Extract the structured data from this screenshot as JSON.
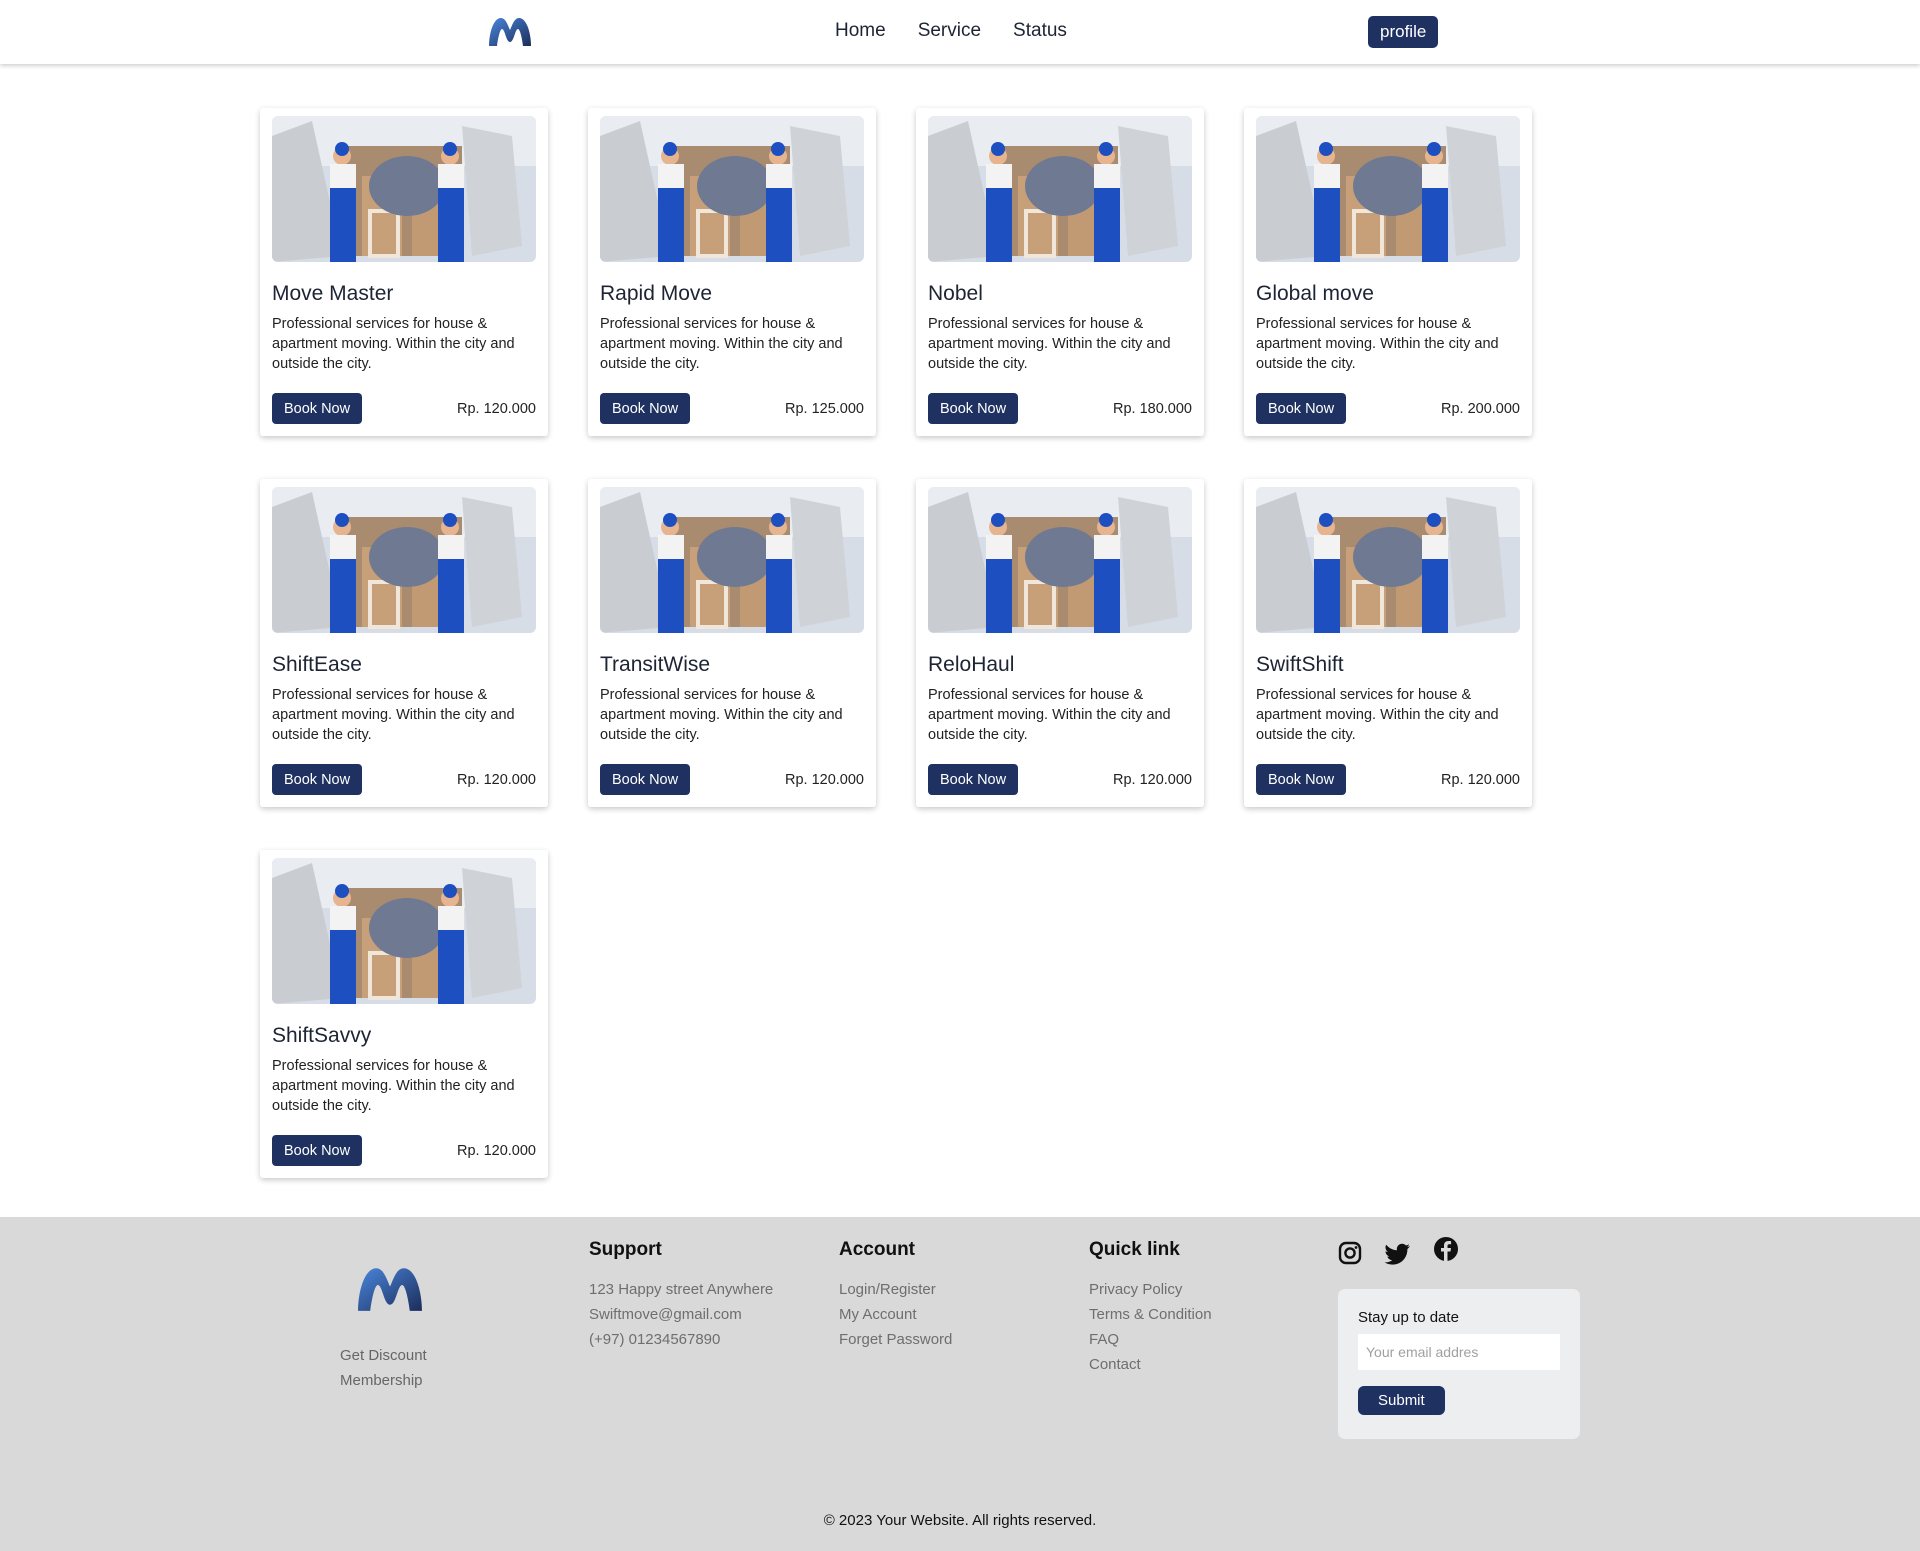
{
  "header": {
    "nav": [
      "Home",
      "Service",
      "Status"
    ],
    "profile_label": "profile"
  },
  "cards": [
    {
      "title": "Move Master",
      "description": "Professional services for house & apartment moving. Within the city and outside the city.",
      "button": "Book Now",
      "price": "Rp. 120.000"
    },
    {
      "title": "Rapid Move",
      "description": "Professional services for house & apartment moving. Within the city and outside the city.",
      "button": "Book Now",
      "price": "Rp. 125.000"
    },
    {
      "title": "Nobel",
      "description": "Professional services for house & apartment moving. Within the city and outside the city.",
      "button": "Book Now",
      "price": "Rp. 180.000"
    },
    {
      "title": "Global move",
      "description": "Professional services for house & apartment moving. Within the city and outside the city.",
      "button": "Book Now",
      "price": "Rp. 200.000"
    },
    {
      "title": "ShiftEase",
      "description": "Professional services for house & apartment moving. Within the city and outside the city.",
      "button": "Book Now",
      "price": "Rp. 120.000"
    },
    {
      "title": "TransitWise",
      "description": "Professional services for house & apartment moving. Within the city and outside the city.",
      "button": "Book Now",
      "price": "Rp. 120.000"
    },
    {
      "title": "ReloHaul",
      "description": "Professional services for house & apartment moving. Within the city and outside the city.",
      "button": "Book Now",
      "price": "Rp. 120.000"
    },
    {
      "title": "SwiftShift",
      "description": "Professional services for house & apartment moving. Within the city and outside the city.",
      "button": "Book Now",
      "price": "Rp. 120.000"
    },
    {
      "title": "ShiftSavvy",
      "description": "Professional services for house & apartment moving. Within the city and outside the city.",
      "button": "Book Now",
      "price": "Rp. 120.000"
    }
  ],
  "footer": {
    "brand_links": [
      "Get Discount",
      "Membership"
    ],
    "support": {
      "heading": "Support",
      "items": [
        "123 Happy street Anywhere",
        "Swiftmove@gmail.com",
        "(+97) 01234567890"
      ]
    },
    "account": {
      "heading": "Account",
      "items": [
        "Login/Register",
        "My Account",
        "Forget Password"
      ]
    },
    "quick_link": {
      "heading": "Quick link",
      "items": [
        "Privacy Policy",
        "Terms & Condition",
        "FAQ",
        "Contact"
      ]
    },
    "socials": [
      "instagram-icon",
      "twitter-icon",
      "facebook-icon"
    ],
    "newsletter": {
      "title": "Stay up to date",
      "placeholder": "Your email addres",
      "button": "Submit"
    },
    "copyright": "© 2023 Your Website. All rights reserved."
  },
  "colors": {
    "primary": "#1e3160",
    "footer_bg": "#d9d9d9",
    "logo_gradient_start": "#3f74c9",
    "logo_gradient_end": "#1c2d5a"
  }
}
